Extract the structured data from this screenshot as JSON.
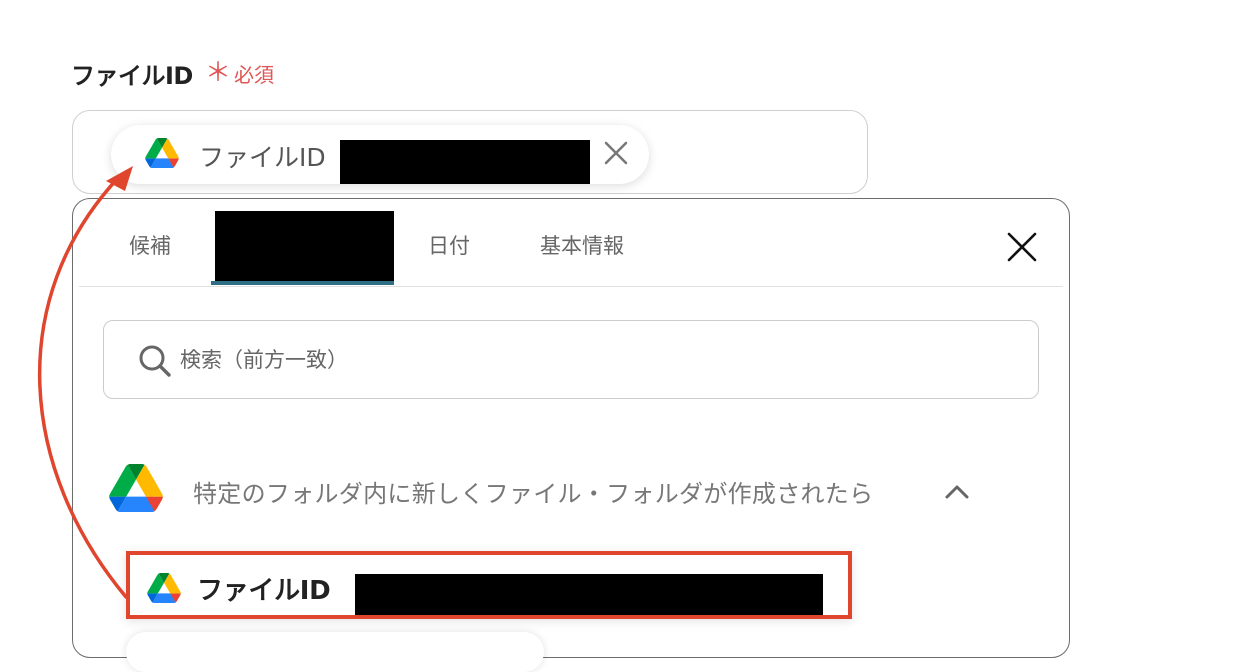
{
  "field": {
    "label": "ファイルID",
    "required_mark": "＊",
    "required_text": "必須"
  },
  "chip": {
    "icon": "google-drive-icon",
    "label": "ファイルID"
  },
  "tabs": {
    "candidates": "候補",
    "date": "日付",
    "basic_info": "基本情報"
  },
  "search": {
    "placeholder": "検索（前方一致）"
  },
  "group": {
    "icon": "google-drive-icon",
    "title": "特定のフォルダ内に新しくファイル・フォルダが作成されたら"
  },
  "item": {
    "icon": "google-drive-icon",
    "label": "ファイルID"
  },
  "colors": {
    "required": "#e05555",
    "highlight": "#e0452e",
    "tab_active": "#2f6f86",
    "drive_green": "#1fa463",
    "drive_yellow": "#ffd04b",
    "drive_blue": "#4688f4"
  }
}
